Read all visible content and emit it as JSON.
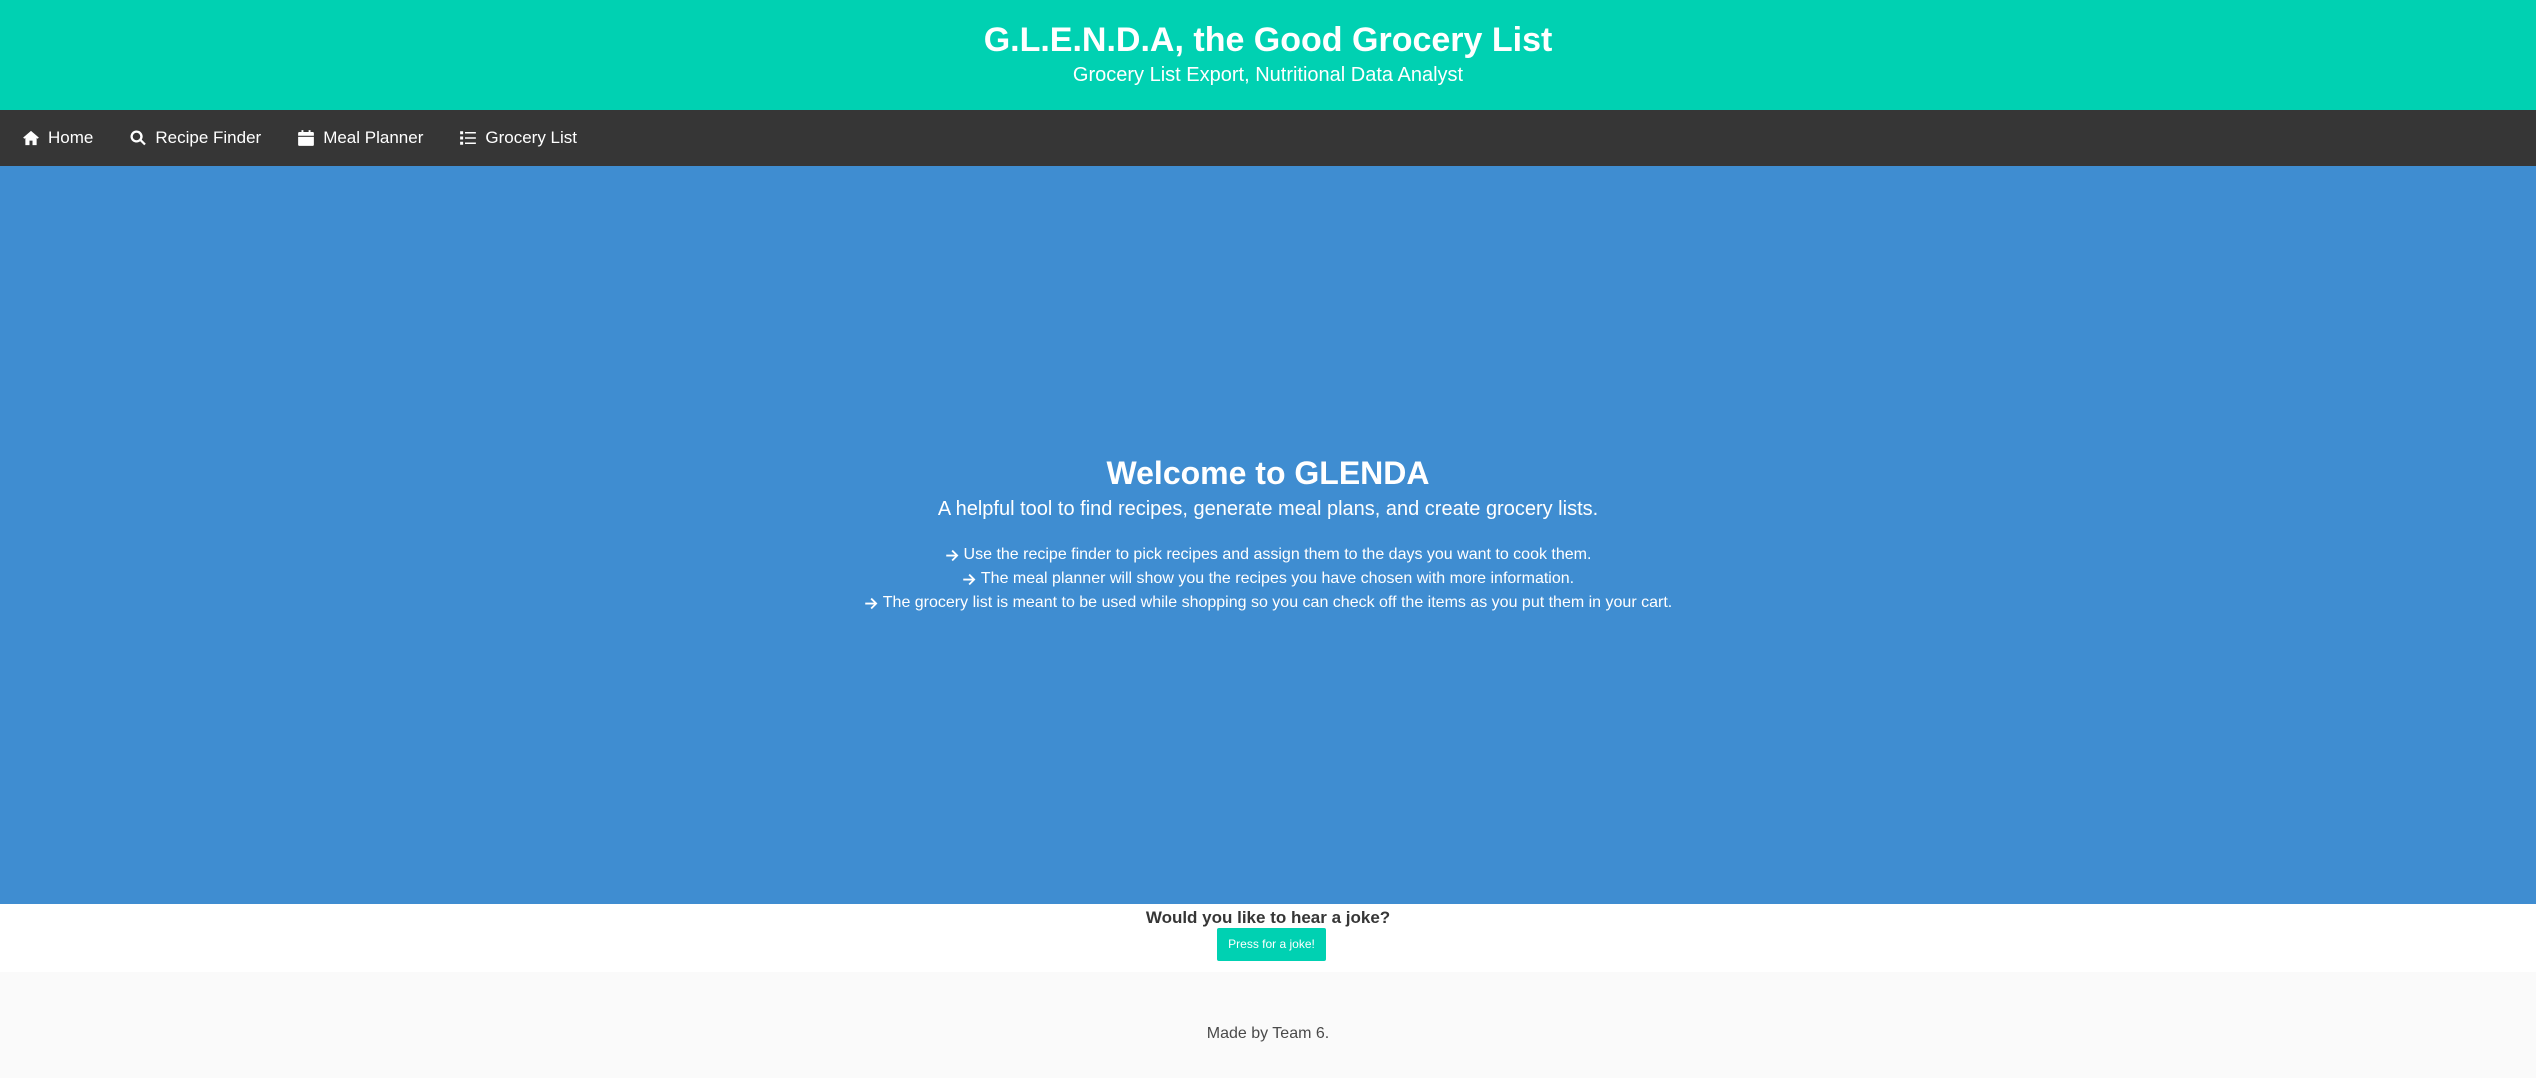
{
  "header": {
    "title": "G.L.E.N.D.A, the Good Grocery List",
    "subtitle": "Grocery List Export, Nutritional Data Analyst"
  },
  "nav": {
    "items": [
      {
        "icon": "home-icon",
        "label": "Home"
      },
      {
        "icon": "search-icon",
        "label": "Recipe Finder"
      },
      {
        "icon": "calendar-icon",
        "label": "Meal Planner"
      },
      {
        "icon": "list-icon",
        "label": "Grocery List"
      }
    ]
  },
  "hero": {
    "title": "Welcome to GLENDA",
    "tagline": "A helpful tool to find recipes, generate meal plans, and create grocery lists.",
    "steps": [
      "Use the recipe finder to pick recipes and assign them to the days you want to cook them.",
      "The meal planner will show you the recipes you have chosen with more information.",
      "The grocery list is meant to be used while shopping so you can check off the items as you put them in your cart."
    ]
  },
  "joke": {
    "question": "Would you like to hear a joke?",
    "button_label": "Press for a joke!"
  },
  "footer": {
    "credit": "Made by Team 6."
  },
  "colors": {
    "header_bg": "#00d1b2",
    "nav_bg": "#363636",
    "hero_bg": "#3f8dd1",
    "button_bg": "#00d1b2",
    "footer_bg": "#fafafa"
  }
}
